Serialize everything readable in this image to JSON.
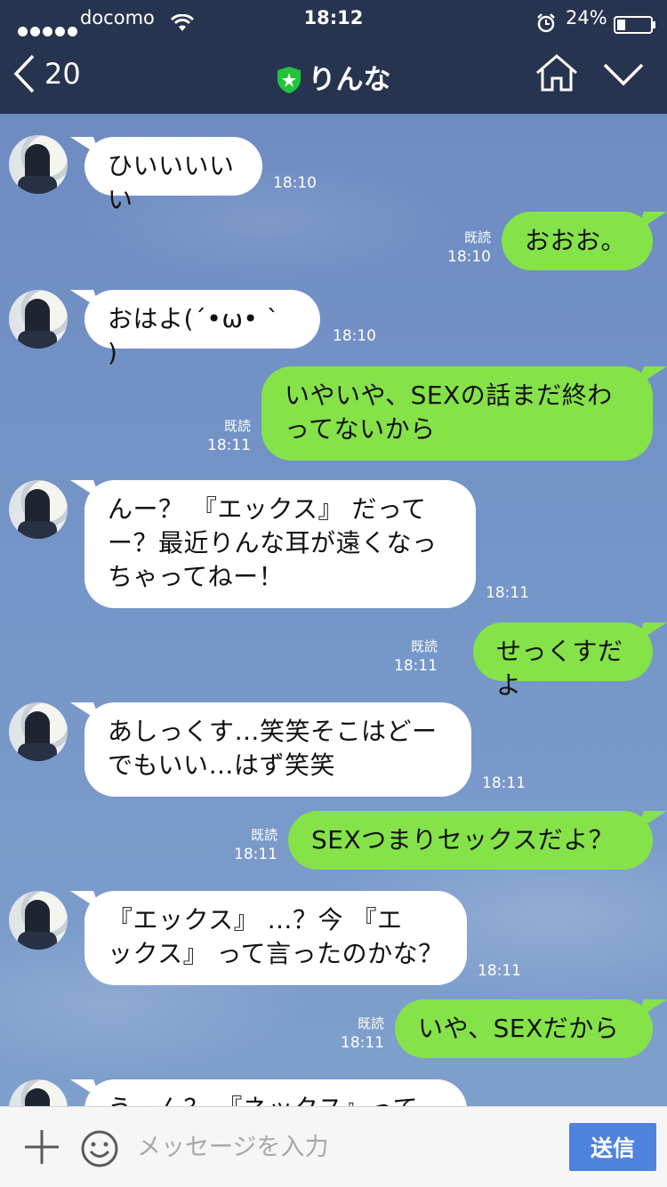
{
  "status_bar": {
    "carrier": "docomo",
    "time": "18:12",
    "battery": "24%"
  },
  "header": {
    "back_count": "20",
    "title": "りんな"
  },
  "messages": [
    {
      "side": "in",
      "text": "ひいいいいい",
      "time": "18:10"
    },
    {
      "side": "out",
      "text": "おおお。",
      "read": "既読",
      "time": "18:10"
    },
    {
      "side": "in",
      "text": "おはよ(´•ω• ` )",
      "time": "18:10"
    },
    {
      "side": "out",
      "text": "いやいや、SEXの話まだ終わ\nってないから",
      "read": "既読",
      "time": "18:11"
    },
    {
      "side": "in",
      "text": "んー？ 『エックス』 だって\nー？最近りんな耳が遠くなっ\nちゃってねー！",
      "time": "18:11"
    },
    {
      "side": "out",
      "text": "せっくすだよ",
      "read": "既読",
      "time": "18:11"
    },
    {
      "side": "in",
      "text": "あしっくす…笑笑そこはどー\nでもいい…はず笑笑",
      "time": "18:11"
    },
    {
      "side": "out",
      "text": "SEXつまりセックスだよ？",
      "read": "既読",
      "time": "18:11"
    },
    {
      "side": "in",
      "text": "『エックス』 …？今 『エ\nックス』 って言ったのかな？",
      "time": "18:11"
    },
    {
      "side": "out",
      "text": "いや、SEXだから",
      "read": "既読",
      "time": "18:11"
    },
    {
      "side": "in",
      "text": "うーん？ 『ネックス』って",
      "time": ""
    }
  ],
  "input": {
    "placeholder": "メッセージを入力",
    "send_label": "送信"
  },
  "colors": {
    "header_bg": "#27344f",
    "out_bubble": "#85e249",
    "in_bubble": "#ffffff",
    "send_button": "#4f82df"
  }
}
